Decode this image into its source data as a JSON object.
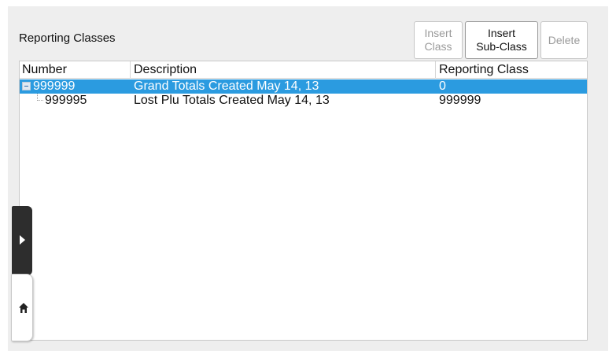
{
  "panel": {
    "title": "Reporting Classes"
  },
  "toolbar": {
    "insert_class_line1": "Insert",
    "insert_class_line2": "Class",
    "insert_sub_class_line1": "Insert",
    "insert_sub_class_line2": "Sub-Class",
    "delete_label": "Delete"
  },
  "table": {
    "columns": [
      "Number",
      "Description",
      "Reporting Class"
    ],
    "rows": [
      {
        "number": "999999",
        "description": "Grand Totals Created May 14, 13",
        "reporting_class": "0",
        "selected": true,
        "expanded": true
      },
      {
        "number": "999995",
        "description": "Lost Plu Totals Created May 14, 13",
        "reporting_class": "999999",
        "selected": false,
        "child": true
      }
    ]
  },
  "icons": {
    "collapse": "minus-box-icon",
    "side_tab": "chevron-right-icon",
    "home": "home-icon"
  },
  "colors": {
    "selection": "#2b9be0",
    "side_tab": "#2d2d2d"
  }
}
